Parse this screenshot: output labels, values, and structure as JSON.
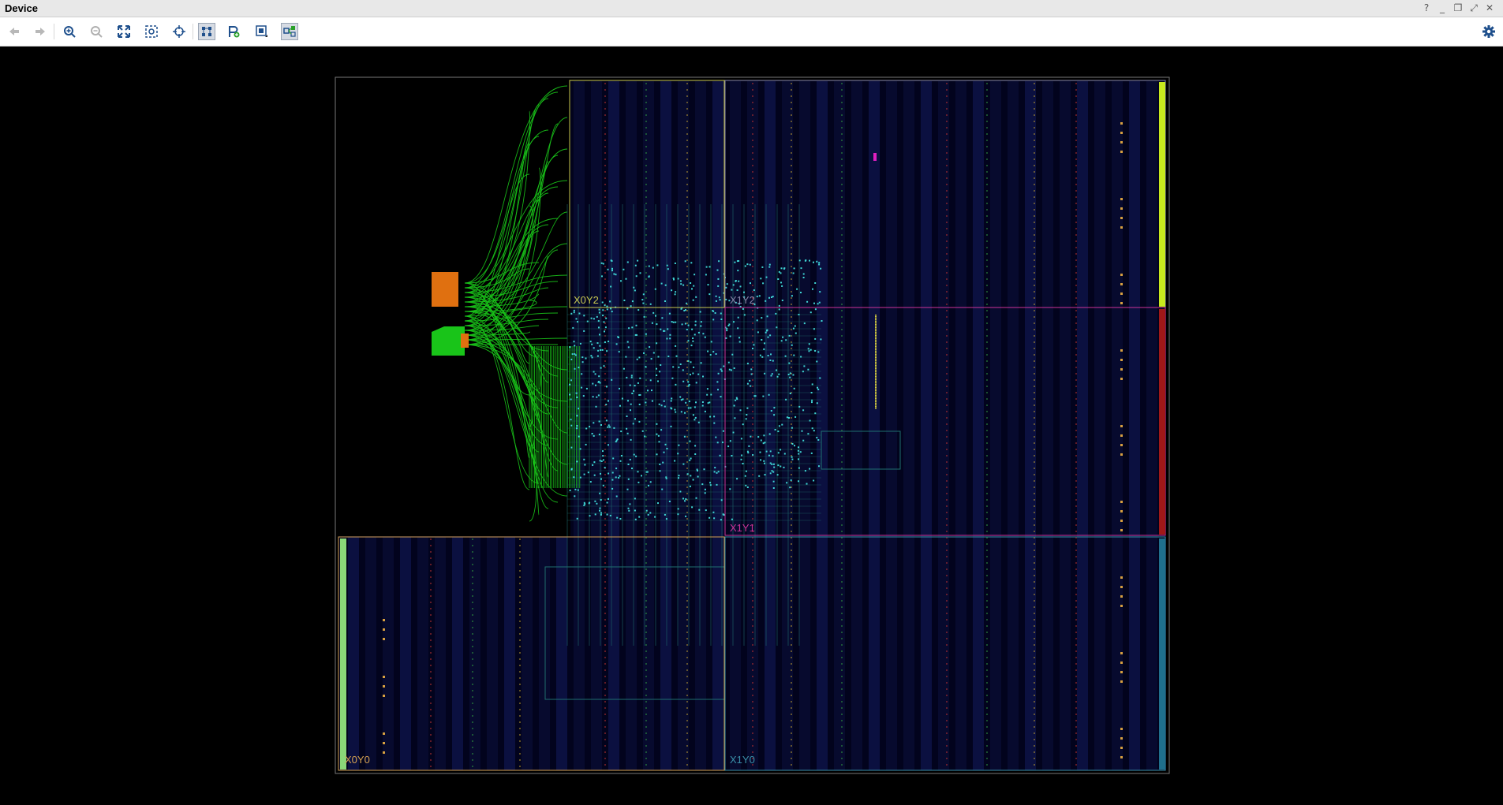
{
  "window": {
    "title": "Device"
  },
  "window_controls": [
    {
      "name": "help-icon",
      "glyph": "?"
    },
    {
      "name": "minimize-icon",
      "glyph": "_"
    },
    {
      "name": "restore-icon",
      "glyph": "❐"
    },
    {
      "name": "maximize-icon",
      "glyph": "⤢"
    },
    {
      "name": "close-icon",
      "glyph": "✕"
    }
  ],
  "toolbar": {
    "buttons": [
      {
        "name": "back-button",
        "icon": "arrow-left-icon",
        "enabled": false
      },
      {
        "name": "forward-button",
        "icon": "arrow-right-icon",
        "enabled": false
      },
      {
        "name": "zoom-in-button",
        "icon": "zoom-in-icon",
        "enabled": true
      },
      {
        "name": "zoom-out-button",
        "icon": "zoom-out-icon",
        "enabled": false
      },
      {
        "name": "zoom-fit-button",
        "icon": "zoom-fit-icon",
        "enabled": true
      },
      {
        "name": "zoom-selected-button",
        "icon": "zoom-selected-icon",
        "enabled": true
      },
      {
        "name": "auto-fit-selection-button",
        "icon": "crosshair-icon",
        "enabled": true
      },
      {
        "name": "routing-resources-button",
        "icon": "routing-icon",
        "active": true
      },
      {
        "name": "add-pblock-button",
        "icon": "pblock-add-icon",
        "enabled": true
      },
      {
        "name": "draw-pblock-button",
        "icon": "pblock-draw-icon",
        "enabled": true
      },
      {
        "name": "show-connections-button",
        "icon": "connections-icon",
        "active": true
      }
    ],
    "settings_icon": "gear-icon"
  },
  "device_view": {
    "clock_regions": [
      {
        "label": "X0Y2",
        "color": "#c8c850"
      },
      {
        "label": "X1Y2",
        "color": "#8888aa"
      },
      {
        "label": "X1Y1",
        "color": "#cc3399"
      },
      {
        "label": "X0Y0",
        "color": "#d4a050"
      },
      {
        "label": "X1Y0",
        "color": "#3a8fa8"
      }
    ],
    "net_colors": {
      "routed_nets": "#19c419",
      "cells": "#3fd4d4",
      "io_bank": "#e07010",
      "bufg_top": "#c8e81e",
      "bufg_mid": "#a01818",
      "bufg_bottom_left": "#8ad878",
      "bufg_bottom_right": "#1f6f8c"
    }
  }
}
